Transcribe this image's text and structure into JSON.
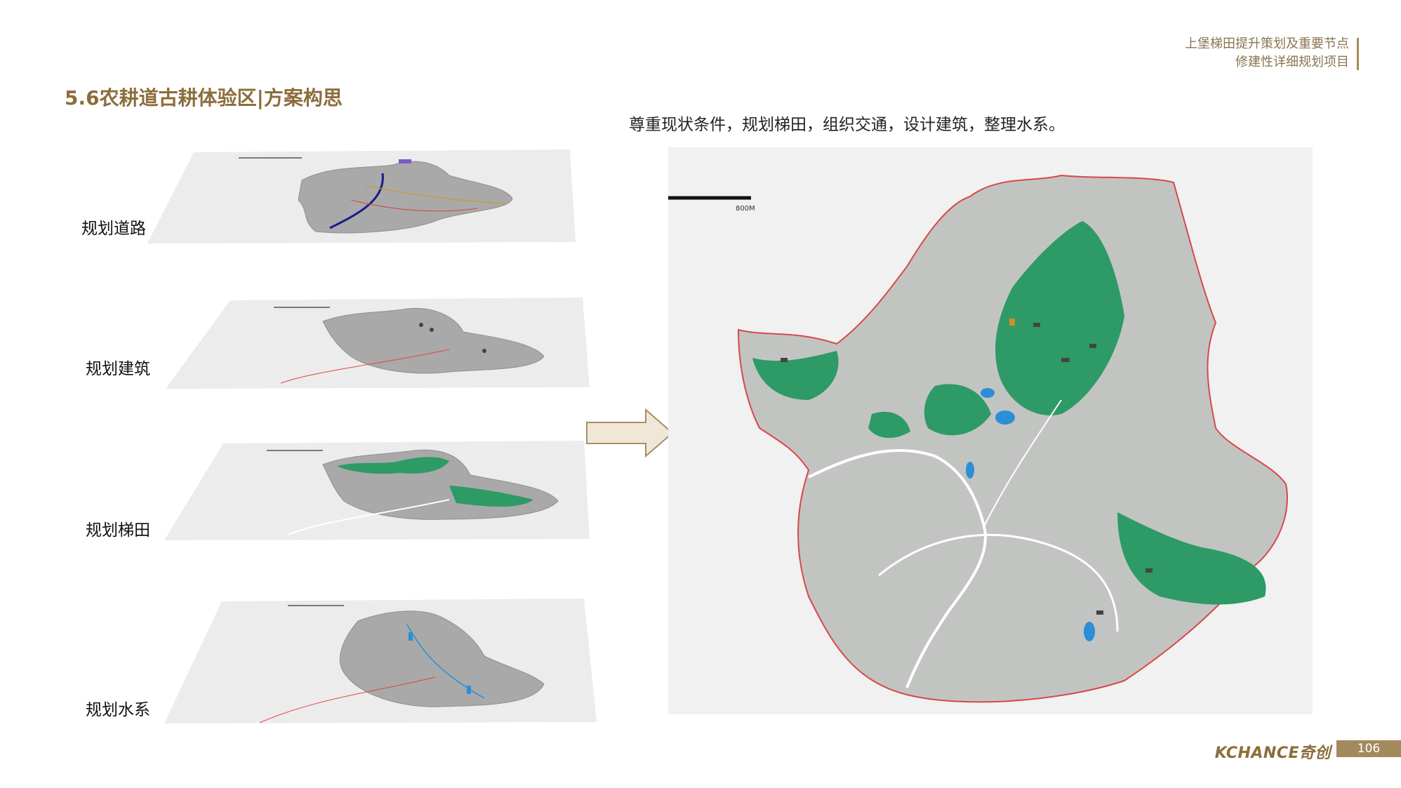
{
  "header": {
    "line1": "上堡梯田提升策划及重要节点",
    "line2": "修建性详细规划项目"
  },
  "title": "5.6农耕道古耕体验区|方案构思",
  "subtitle": "尊重现状条件，规划梯田，组织交通，设计建筑，整理水系。",
  "layers": [
    {
      "label": "规划道路"
    },
    {
      "label": "规划建筑"
    },
    {
      "label": "规划梯田"
    },
    {
      "label": "规划水系"
    }
  ],
  "map": {
    "scale_label": "800M"
  },
  "footer": {
    "brand": "KCHANCE奇创",
    "page_number": "106"
  },
  "colors": {
    "accent": "#8c6d3b",
    "boundary": "#d94848",
    "terrace_green": "#2e9a66",
    "water_blue": "#2b8fd6",
    "arrow_fill": "#f1e7d8",
    "arrow_stroke": "#a98d62"
  }
}
